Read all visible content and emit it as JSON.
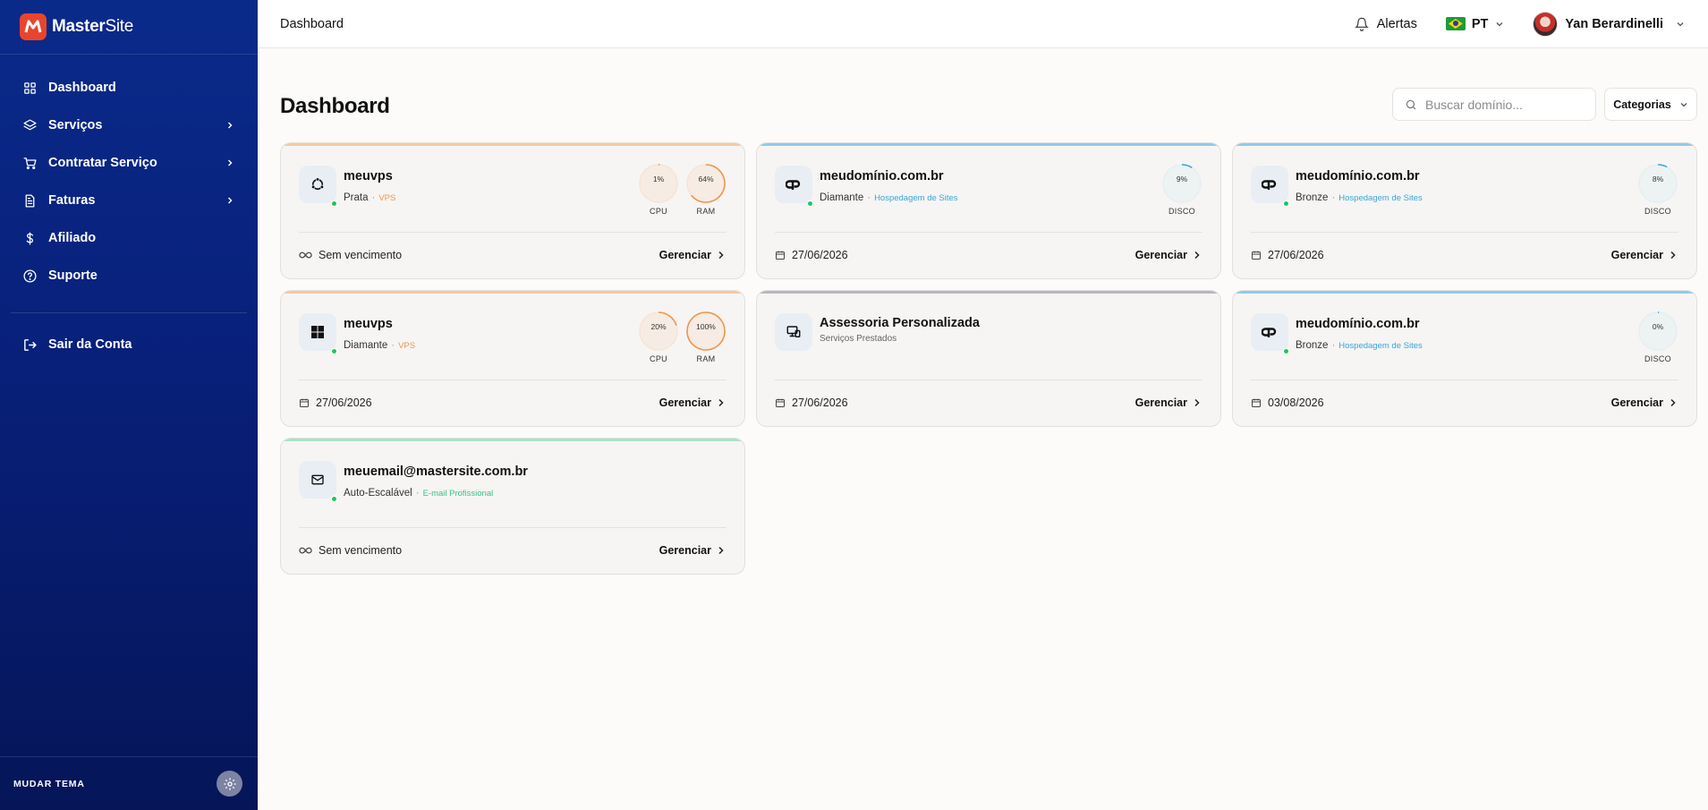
{
  "brand": {
    "name_bold": "Master",
    "name_light": "Site",
    "accent": "#e8452e"
  },
  "sidebar": {
    "items": [
      {
        "label": "Dashboard",
        "icon": "grid-icon",
        "has_submenu": false
      },
      {
        "label": "Serviços",
        "icon": "layers-icon",
        "has_submenu": true
      },
      {
        "label": "Contratar Serviço",
        "icon": "cart-icon",
        "has_submenu": true
      },
      {
        "label": "Faturas",
        "icon": "file-icon",
        "has_submenu": true
      },
      {
        "label": "Afiliado",
        "icon": "dollar-icon",
        "has_submenu": false
      },
      {
        "label": "Suporte",
        "icon": "help-icon",
        "has_submenu": false
      }
    ],
    "logout_label": "Sair da Conta",
    "theme_label": "MUDAR TEMA"
  },
  "header": {
    "breadcrumb": "Dashboard",
    "alerts_label": "Alertas",
    "language": "PT",
    "user_name": "Yan Berardinelli"
  },
  "main": {
    "title": "Dashboard",
    "search_placeholder": "Buscar domínio...",
    "categories_label": "Categorias",
    "manage_label": "Gerenciar",
    "cards": [
      {
        "name": "meuvps",
        "plan": "Prata",
        "tag": "VPS",
        "tag_color": "#f0954a",
        "accent": "#f6c8a2",
        "icon": "ubuntu-icon",
        "status": "active",
        "footer_icon": "infinity-icon",
        "footer": "Sem vencimento",
        "gauges": [
          {
            "label": "CPU",
            "value": 1,
            "text": "1%"
          },
          {
            "label": "RAM",
            "value": 64,
            "text": "64%"
          }
        ]
      },
      {
        "name": "meudomínio.com.br",
        "plan": "Diamante",
        "tag": "Hospedagem de Sites",
        "tag_color": "#3aa5d6",
        "accent": "#8fcbe8",
        "icon": "cpanel-icon",
        "status": "active",
        "footer_icon": "calendar-icon",
        "footer": "27/06/2026",
        "gauges": [
          {
            "label": "DISCO",
            "value": 9,
            "text": "9%"
          }
        ]
      },
      {
        "name": "meudomínio.com.br",
        "plan": "Bronze",
        "tag": "Hospedagem de Sites",
        "tag_color": "#3aa5d6",
        "accent": "#8fcbe8",
        "icon": "cpanel-icon",
        "status": "active",
        "footer_icon": "calendar-icon",
        "footer": "27/06/2026",
        "gauges": [
          {
            "label": "DISCO",
            "value": 8,
            "text": "8%"
          }
        ]
      },
      {
        "name": "meuvps",
        "plan": "Diamante",
        "tag": "VPS",
        "tag_color": "#f0954a",
        "accent": "#f6c8a2",
        "icon": "windows-icon",
        "status": "active",
        "footer_icon": "calendar-icon",
        "footer": "27/06/2026",
        "gauges": [
          {
            "label": "CPU",
            "value": 20,
            "text": "20%"
          },
          {
            "label": "RAM",
            "value": 100,
            "text": "100%"
          }
        ]
      },
      {
        "name": "Assessoria Personalizada",
        "plan": "",
        "tag": "",
        "subtitle": "Serviços Prestados",
        "accent": "#b8b6c2",
        "icon": "devices-icon",
        "status": "none",
        "footer_icon": "calendar-icon",
        "footer": "27/06/2026",
        "gauges": []
      },
      {
        "name": "meudomínio.com.br",
        "plan": "Bronze",
        "tag": "Hospedagem de Sites",
        "tag_color": "#3aa5d6",
        "accent": "#8fcbe8",
        "icon": "cpanel-icon",
        "status": "active",
        "footer_icon": "calendar-icon",
        "footer": "03/08/2026",
        "gauges": [
          {
            "label": "DISCO",
            "value": 0,
            "text": "0%"
          }
        ]
      },
      {
        "name": "meuemail@mastersite.com.br",
        "plan": "Auto-Escalável",
        "tag": "E-mail Profissional",
        "tag_color": "#34c48a",
        "accent": "#a8e2c8",
        "icon": "mail-icon",
        "status": "active",
        "footer_icon": "infinity-icon",
        "footer": "Sem vencimento",
        "gauges": []
      }
    ]
  },
  "colors": {
    "vps_gauge": "#f0954a",
    "disk_gauge": "#3aa5d6",
    "status_active": "#22c55e"
  }
}
